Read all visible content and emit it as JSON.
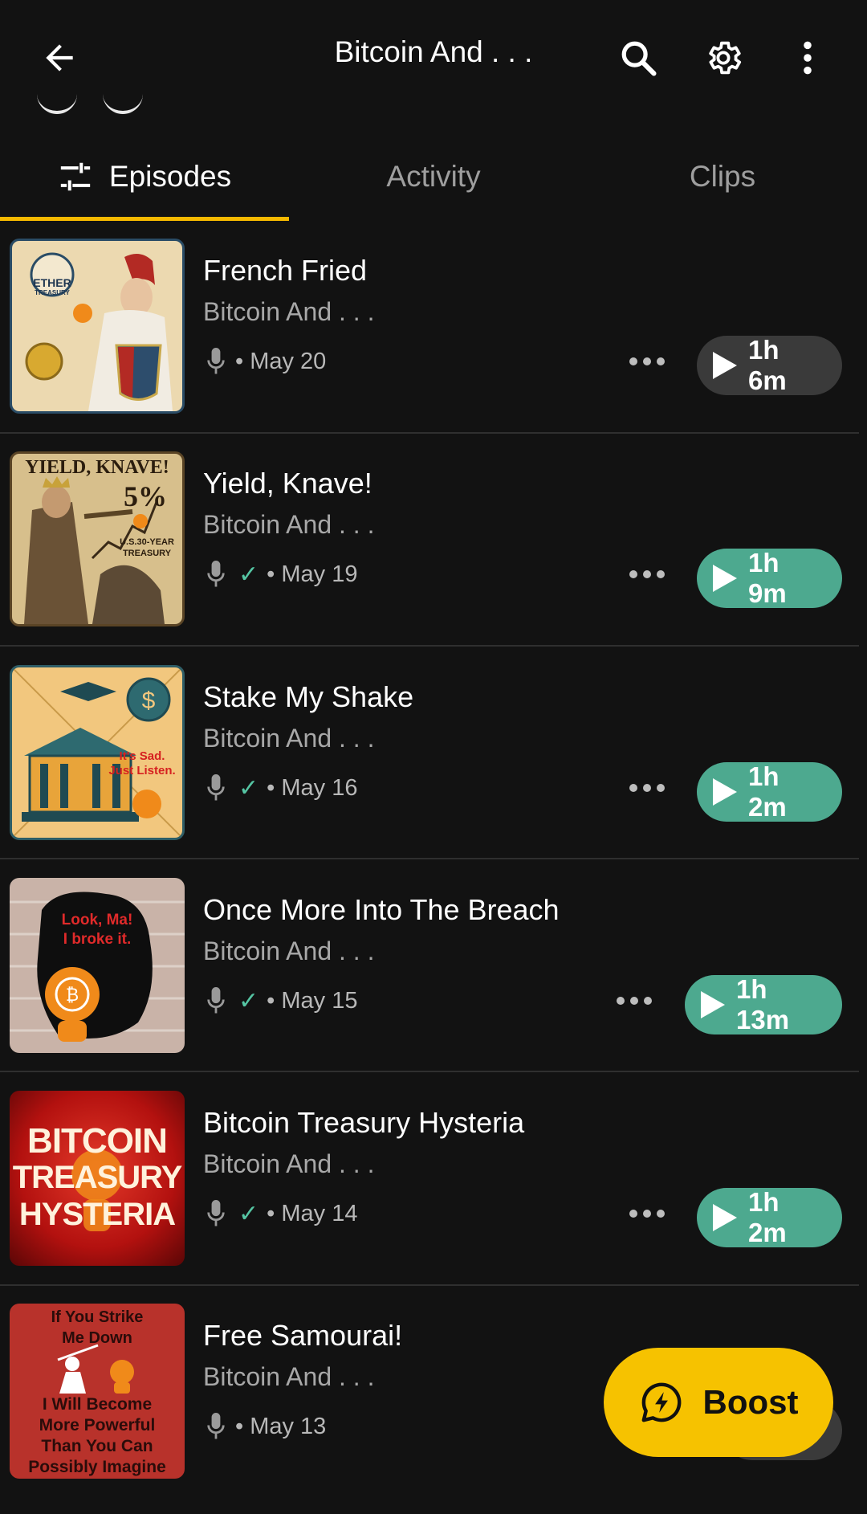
{
  "header": {
    "back_icon": "arrow-left-icon",
    "title": "Bitcoin And . . .",
    "search_icon": "search-icon",
    "settings_icon": "gear-icon",
    "menu_icon": "more-vertical-icon"
  },
  "tabs": [
    {
      "label": "Episodes",
      "icon": "filter-sliders-icon",
      "active": true
    },
    {
      "label": "Activity",
      "active": false
    },
    {
      "label": "Clips",
      "active": false
    }
  ],
  "colors": {
    "background": "#121212",
    "accent": "#f6b900",
    "play_teal": "#4da98f",
    "play_grey": "#3a3a3a",
    "check_green": "#55c5a3",
    "boost": "#f6c200"
  },
  "episodes": [
    {
      "title": "French Fried",
      "show": "Bitcoin And . . .",
      "date": "• May 20",
      "played": false,
      "duration": "1h 6m",
      "thumb_text": [
        "ETHER",
        "TREASURY"
      ]
    },
    {
      "title": "Yield, Knave!",
      "show": "Bitcoin And . . .",
      "date": "• May 19",
      "played": true,
      "duration": "1h 9m",
      "thumb_text": [
        "YIELD, KNAVE!",
        "5%",
        "U.S.30-YEAR",
        "TREASURY"
      ]
    },
    {
      "title": "Stake My Shake",
      "show": "Bitcoin And . . .",
      "date": "• May 16",
      "played": true,
      "duration": "1h 2m",
      "thumb_text": [
        "It's Sad.",
        "Just Listen."
      ]
    },
    {
      "title": "Once More Into The Breach",
      "show": "Bitcoin And . . .",
      "date": "• May 15",
      "played": true,
      "duration": "1h 13m",
      "thumb_text": [
        "Look, Ma!",
        "I broke it."
      ]
    },
    {
      "title": "Bitcoin Treasury Hysteria",
      "show": "Bitcoin And . . .",
      "date": "• May 14",
      "played": true,
      "duration": "1h 2m",
      "thumb_text": [
        "BITCOIN",
        "TREASURY",
        "HYSTERIA"
      ]
    },
    {
      "title": "Free Samourai!",
      "show": "Bitcoin And . . .",
      "date": "• May 13",
      "played": false,
      "duration": "",
      "thumb_text": [
        "If You Strike",
        "Me Down",
        "I Will Become",
        "More Powerful",
        "Than You Can",
        "Possibly Imagine"
      ]
    }
  ],
  "boost": {
    "label": "Boost",
    "icon": "lightning-bubble-icon"
  }
}
